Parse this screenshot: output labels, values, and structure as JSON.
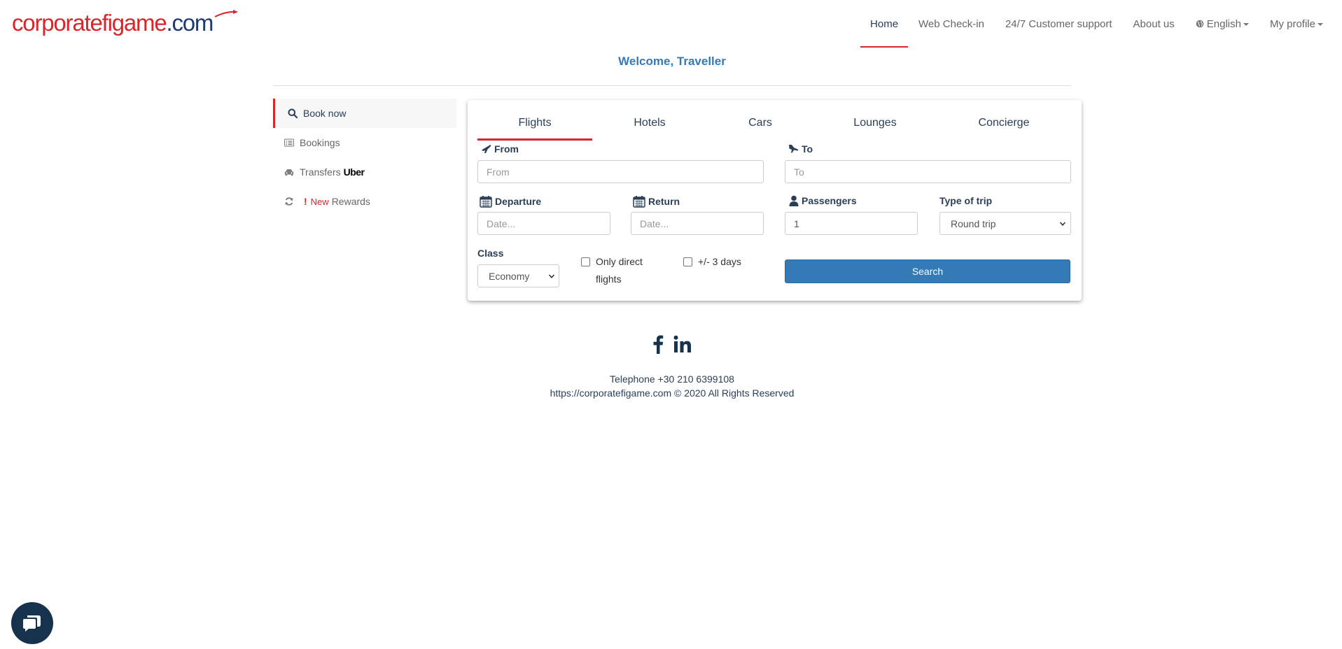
{
  "brand": {
    "logo_part1": "corporate",
    "logo_part2": "figame",
    "logo_part3": ".com",
    "colors": {
      "red": "#d7262c",
      "navy": "#1e3a6e",
      "accent_blue": "#337ab7"
    }
  },
  "nav": {
    "items": [
      {
        "label": "Home",
        "active": true
      },
      {
        "label": "Web Check-in"
      },
      {
        "label": "24/7 Customer support"
      },
      {
        "label": "About us"
      },
      {
        "label": "English",
        "icon": "globe-icon",
        "dropdown": true
      },
      {
        "label": "My profile",
        "dropdown": true
      }
    ]
  },
  "welcome": {
    "text": "Welcome, Traveller"
  },
  "sidebar": {
    "items": [
      {
        "label": "Book now",
        "icon": "search-icon",
        "active": true
      },
      {
        "label": "Bookings",
        "icon": "list-icon"
      },
      {
        "label": "Transfers",
        "icon": "taxi-icon",
        "extra": "Uber"
      },
      {
        "label": "Rewards",
        "icon": "refresh-icon",
        "badge": "New"
      }
    ]
  },
  "tabs": [
    {
      "label": "Flights",
      "active": true
    },
    {
      "label": "Hotels"
    },
    {
      "label": "Cars"
    },
    {
      "label": "Lounges"
    },
    {
      "label": "Concierge"
    }
  ],
  "form": {
    "from": {
      "label": "From",
      "placeholder": "From",
      "value": ""
    },
    "to": {
      "label": "To",
      "placeholder": "To",
      "value": ""
    },
    "departure": {
      "label": "Departure",
      "placeholder": "Date...",
      "value": ""
    },
    "return": {
      "label": "Return",
      "placeholder": "Date...",
      "value": ""
    },
    "passengers": {
      "label": "Passengers",
      "value": "1"
    },
    "trip_type": {
      "label": "Type of trip",
      "value": "Round trip"
    },
    "class": {
      "label": "Class",
      "value": "Economy"
    },
    "only_direct": {
      "label_line1": "Only direct",
      "label_line2": "flights",
      "checked": false
    },
    "flex_days": {
      "label": "+/- 3 days",
      "checked": false
    },
    "search_label": "Search"
  },
  "footer": {
    "social": [
      "facebook-icon",
      "linkedin-icon"
    ],
    "telephone": "Telephone +30 210 6399108",
    "copyright": "https://corporatefigame.com © 2020 All Rights Reserved"
  }
}
